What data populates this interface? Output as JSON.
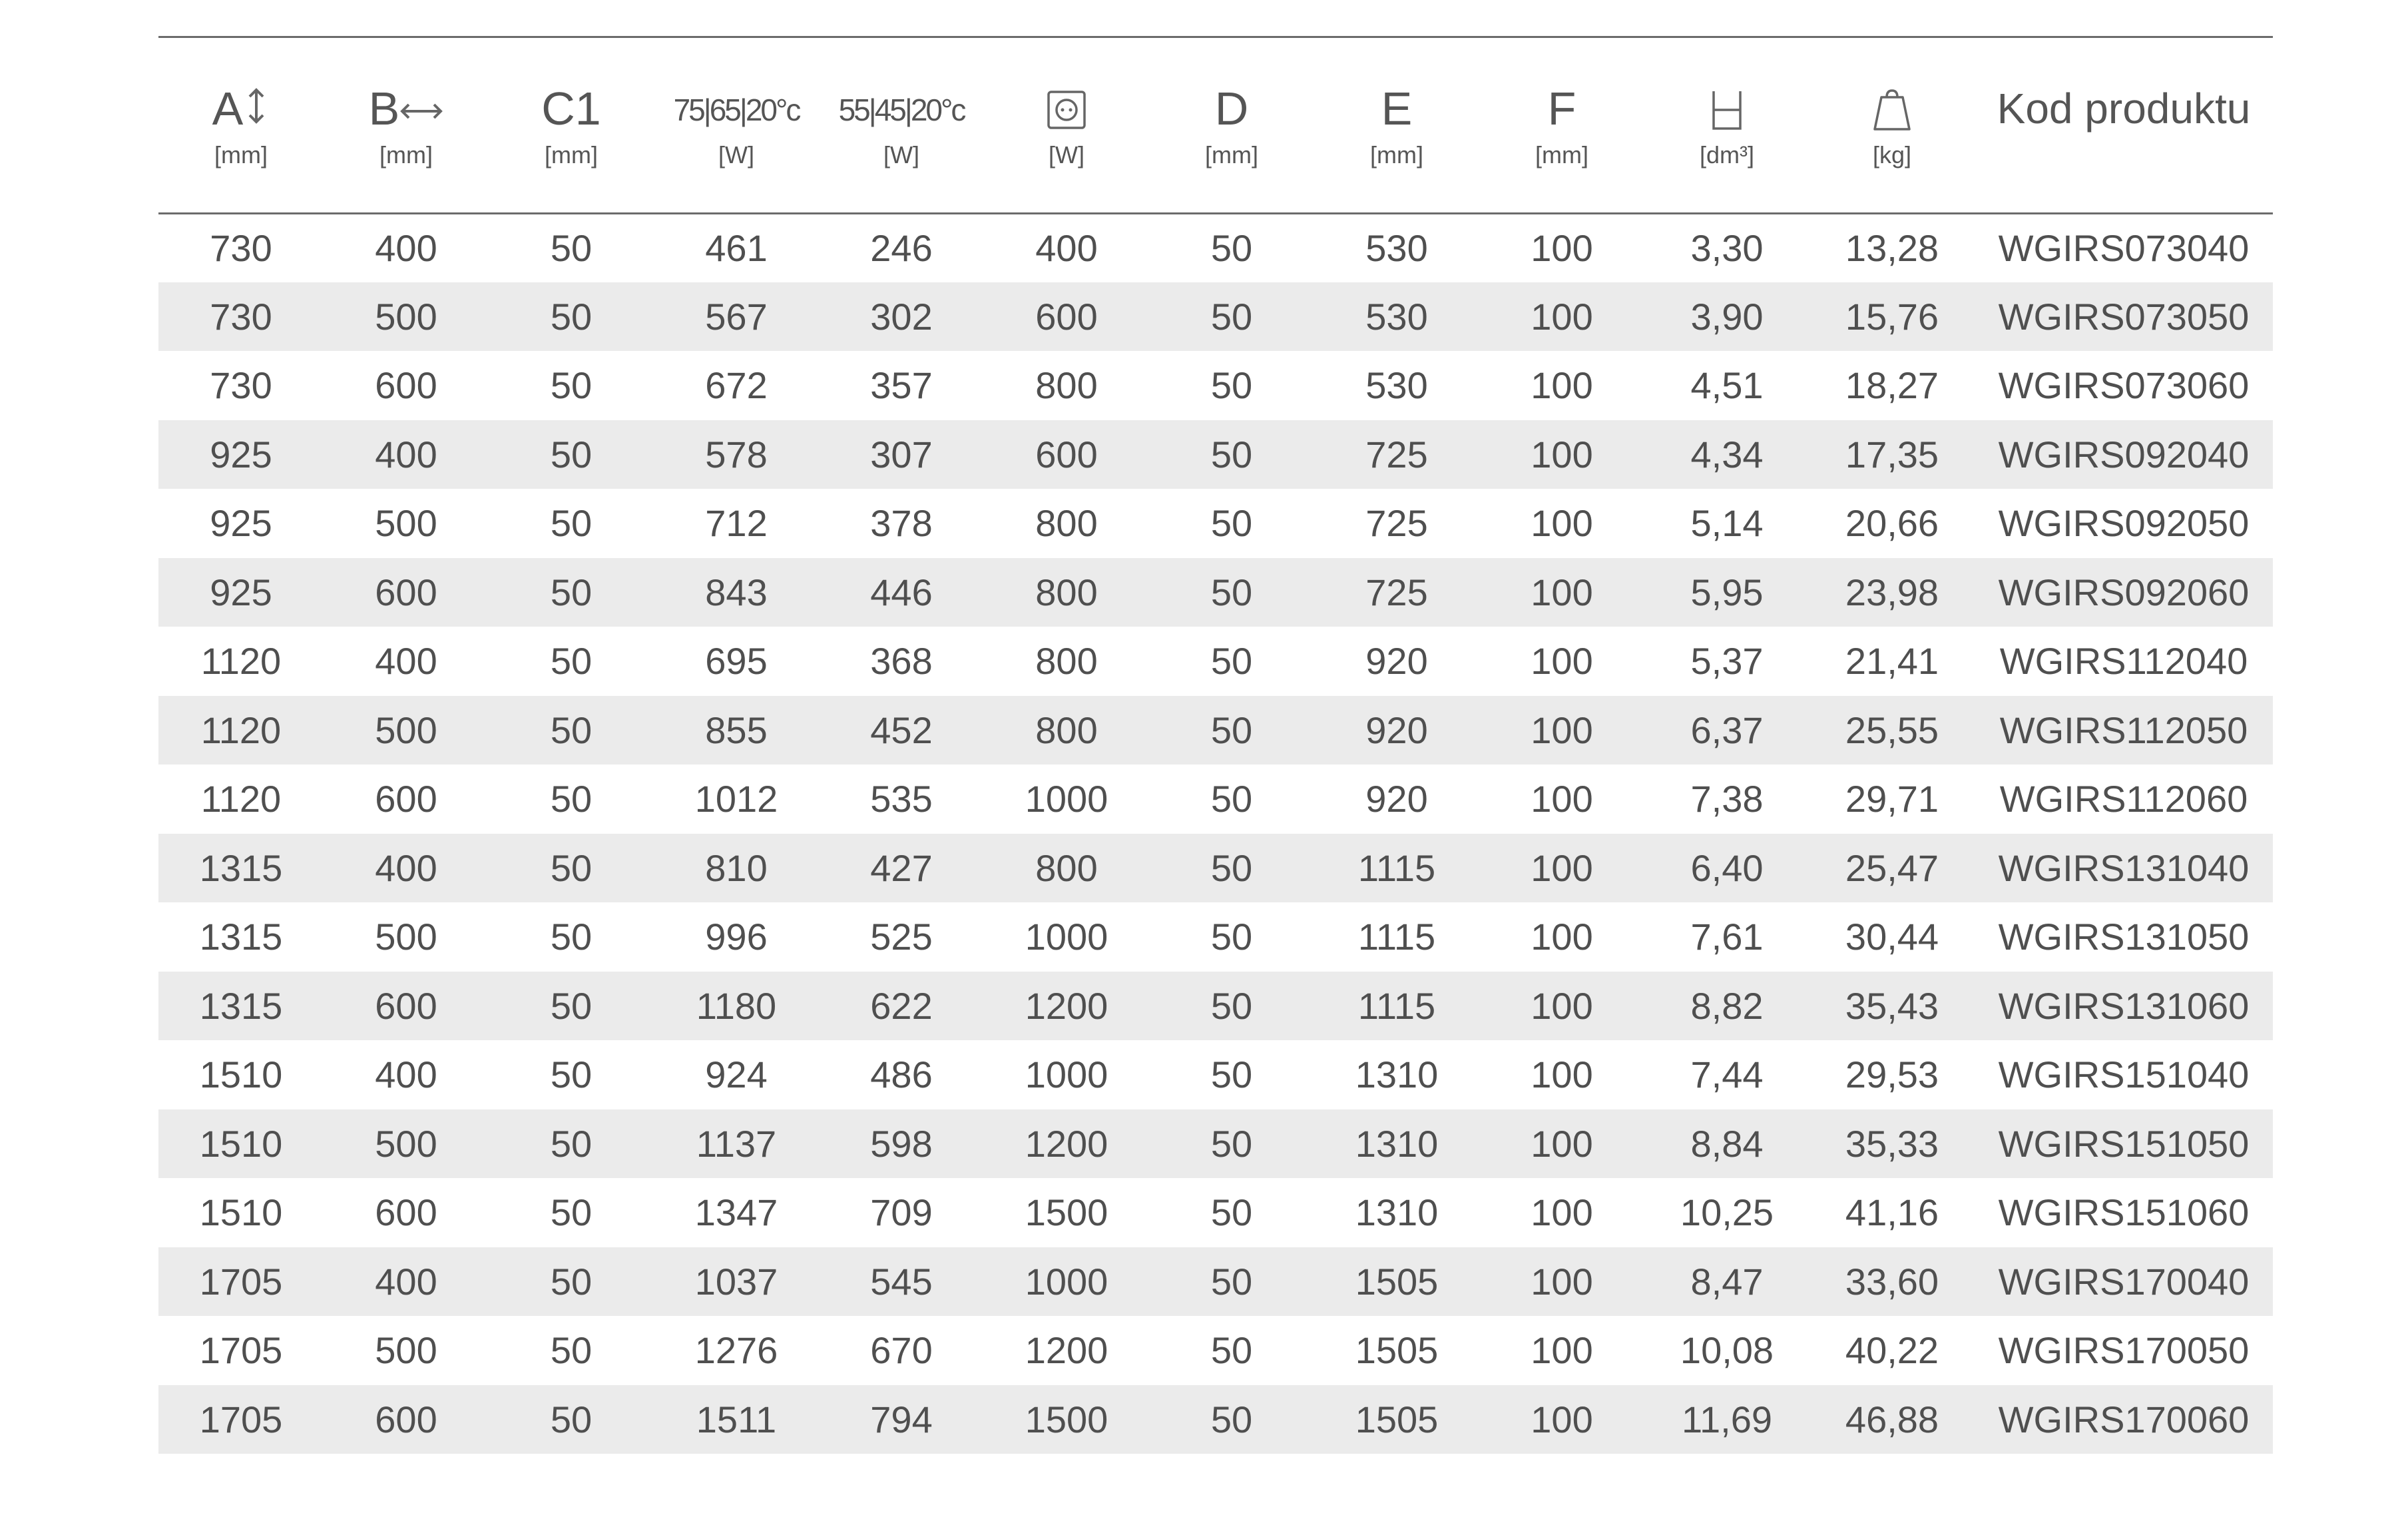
{
  "table": {
    "headers": [
      {
        "main": "A",
        "icon": "vertical-arrow-icon",
        "unit": "[mm]"
      },
      {
        "main": "B",
        "icon": "horizontal-arrow-icon",
        "unit": "[mm]"
      },
      {
        "main": "C1",
        "unit": "[mm]"
      },
      {
        "main": "75|65|20°c",
        "unit": "[W]"
      },
      {
        "main": "55|45|20°c",
        "unit": "[W]"
      },
      {
        "icon": "electric-heater-icon",
        "unit": "[W]"
      },
      {
        "main": "D",
        "unit": "[mm]"
      },
      {
        "main": "E",
        "unit": "[mm]"
      },
      {
        "main": "F",
        "unit": "[mm]"
      },
      {
        "icon": "water-capacity-icon",
        "unit": "[dm³]"
      },
      {
        "icon": "weight-icon",
        "unit": "[kg]"
      },
      {
        "main": "Kod produktu"
      }
    ],
    "rows": [
      [
        "730",
        "400",
        "50",
        "461",
        "246",
        "400",
        "50",
        "530",
        "100",
        "3,30",
        "13,28",
        "WGIRS073040"
      ],
      [
        "730",
        "500",
        "50",
        "567",
        "302",
        "600",
        "50",
        "530",
        "100",
        "3,90",
        "15,76",
        "WGIRS073050"
      ],
      [
        "730",
        "600",
        "50",
        "672",
        "357",
        "800",
        "50",
        "530",
        "100",
        "4,51",
        "18,27",
        "WGIRS073060"
      ],
      [
        "925",
        "400",
        "50",
        "578",
        "307",
        "600",
        "50",
        "725",
        "100",
        "4,34",
        "17,35",
        "WGIRS092040"
      ],
      [
        "925",
        "500",
        "50",
        "712",
        "378",
        "800",
        "50",
        "725",
        "100",
        "5,14",
        "20,66",
        "WGIRS092050"
      ],
      [
        "925",
        "600",
        "50",
        "843",
        "446",
        "800",
        "50",
        "725",
        "100",
        "5,95",
        "23,98",
        "WGIRS092060"
      ],
      [
        "1120",
        "400",
        "50",
        "695",
        "368",
        "800",
        "50",
        "920",
        "100",
        "5,37",
        "21,41",
        "WGIRS112040"
      ],
      [
        "1120",
        "500",
        "50",
        "855",
        "452",
        "800",
        "50",
        "920",
        "100",
        "6,37",
        "25,55",
        "WGIRS112050"
      ],
      [
        "1120",
        "600",
        "50",
        "1012",
        "535",
        "1000",
        "50",
        "920",
        "100",
        "7,38",
        "29,71",
        "WGIRS112060"
      ],
      [
        "1315",
        "400",
        "50",
        "810",
        "427",
        "800",
        "50",
        "1115",
        "100",
        "6,40",
        "25,47",
        "WGIRS131040"
      ],
      [
        "1315",
        "500",
        "50",
        "996",
        "525",
        "1000",
        "50",
        "1115",
        "100",
        "7,61",
        "30,44",
        "WGIRS131050"
      ],
      [
        "1315",
        "600",
        "50",
        "1180",
        "622",
        "1200",
        "50",
        "1115",
        "100",
        "8,82",
        "35,43",
        "WGIRS131060"
      ],
      [
        "1510",
        "400",
        "50",
        "924",
        "486",
        "1000",
        "50",
        "1310",
        "100",
        "7,44",
        "29,53",
        "WGIRS151040"
      ],
      [
        "1510",
        "500",
        "50",
        "1137",
        "598",
        "1200",
        "50",
        "1310",
        "100",
        "8,84",
        "35,33",
        "WGIRS151050"
      ],
      [
        "1510",
        "600",
        "50",
        "1347",
        "709",
        "1500",
        "50",
        "1310",
        "100",
        "10,25",
        "41,16",
        "WGIRS151060"
      ],
      [
        "1705",
        "400",
        "50",
        "1037",
        "545",
        "1000",
        "50",
        "1505",
        "100",
        "8,47",
        "33,60",
        "WGIRS170040"
      ],
      [
        "1705",
        "500",
        "50",
        "1276",
        "670",
        "1200",
        "50",
        "1505",
        "100",
        "10,08",
        "40,22",
        "WGIRS170050"
      ],
      [
        "1705",
        "600",
        "50",
        "1511",
        "794",
        "1500",
        "50",
        "1505",
        "100",
        "11,69",
        "46,88",
        "WGIRS170060"
      ]
    ]
  }
}
